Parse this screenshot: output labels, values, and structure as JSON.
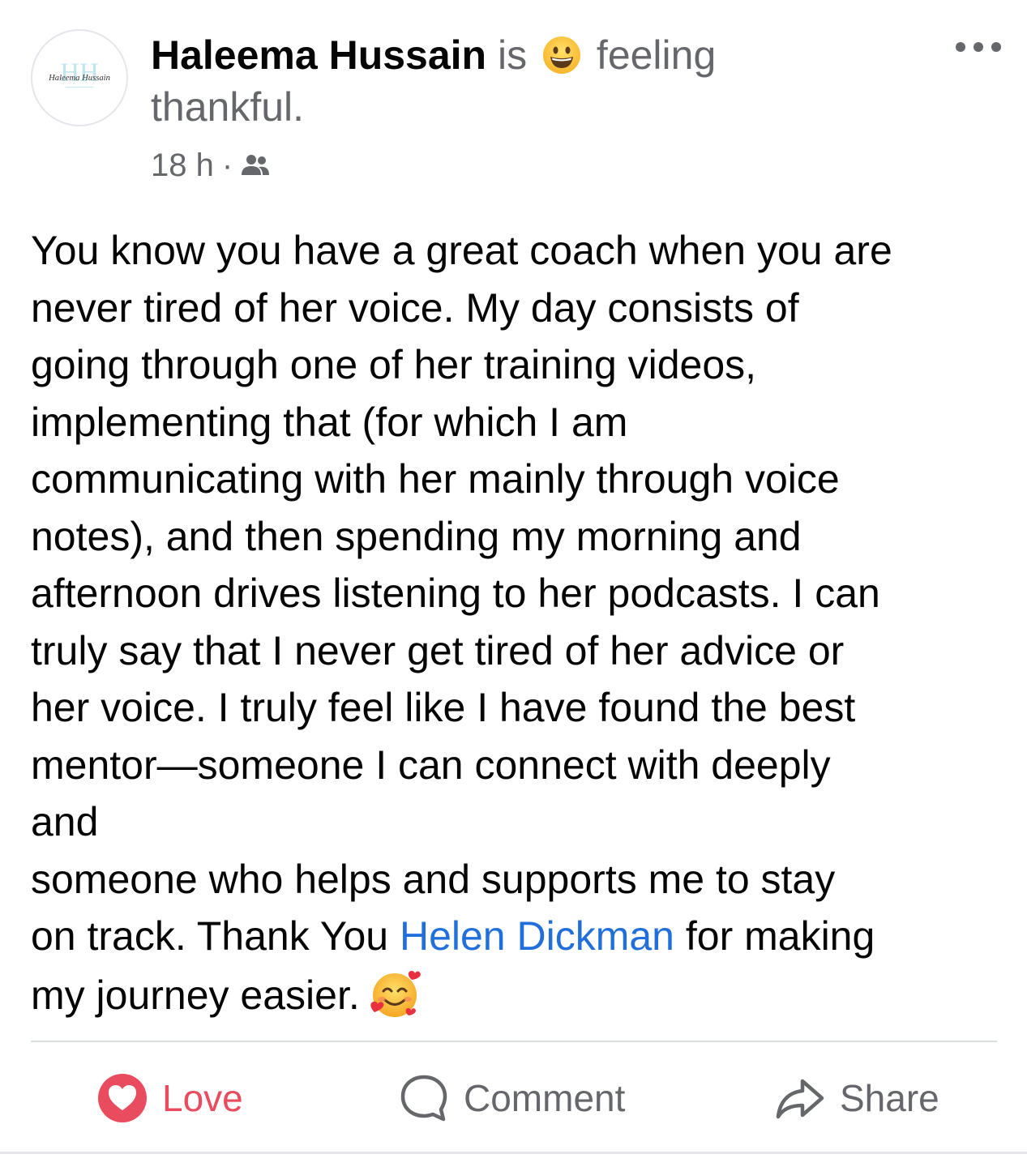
{
  "header": {
    "author": "Haleema Hussain",
    "connector": "is",
    "feeling_text_1": "feeling",
    "feeling_text_2": "thankful.",
    "time": "18 h",
    "separator": "·",
    "audience_icon": "friends-icon",
    "feeling_icon": "grinning-face-emoji",
    "avatar_logo_text": "Haleema Hussain"
  },
  "post": {
    "lines": [
      "You know you have a great coach when you are",
      "never tired of her voice. My day consists of",
      "going through one of her training videos,",
      "implementing that (for which I am",
      "communicating with her mainly through voice",
      "notes), and then spending my morning and",
      "afternoon drives listening to her podcasts. I can",
      "truly say that I never get tired of her advice or",
      "her voice. I truly feel like I have found the best",
      "mentor—someone I can connect with deeply",
      "and",
      "someone who helps and supports me to stay"
    ],
    "line_13_before": "on track. Thank You ",
    "mention": "Helen Dickman",
    "line_13_after": " for making",
    "line_14": "my journey easier.",
    "end_emoji": "smiling-face-with-hearts-emoji"
  },
  "actions": {
    "love_label": "Love",
    "comment_label": "Comment",
    "share_label": "Share",
    "love_color": "#e94c5e",
    "mention_color": "#216fdb",
    "muted_color": "#65676b"
  }
}
